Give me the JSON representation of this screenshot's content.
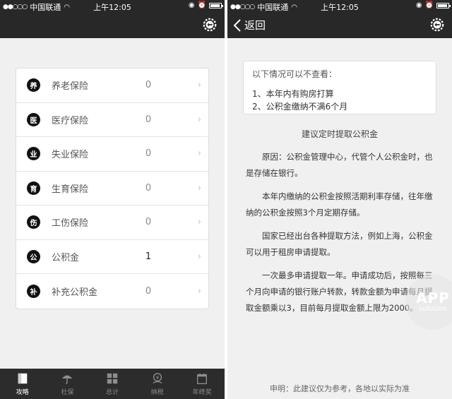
{
  "status_bar": {
    "signal": "●●○○○",
    "carrier": "中国联通",
    "time": "上午12:05"
  },
  "left": {
    "list": [
      {
        "badge": "养",
        "label": "养老保险",
        "value": "0"
      },
      {
        "badge": "医",
        "label": "医疗保险",
        "value": "0"
      },
      {
        "badge": "业",
        "label": "失业保险",
        "value": "0"
      },
      {
        "badge": "育",
        "label": "生育保险",
        "value": "0"
      },
      {
        "badge": "伤",
        "label": "工伤保险",
        "value": "0"
      },
      {
        "badge": "公",
        "label": "公积金",
        "value": "1"
      },
      {
        "badge": "补",
        "label": "补充公积金",
        "value": "0"
      }
    ],
    "tabs": [
      {
        "label": "攻略",
        "icon": "book-icon"
      },
      {
        "label": "社保",
        "icon": "umbrella-icon"
      },
      {
        "label": "总计",
        "icon": "grid-icon"
      },
      {
        "label": "纳税",
        "icon": "yen-icon"
      },
      {
        "label": "年终奖",
        "icon": "calendar-icon"
      }
    ]
  },
  "right": {
    "back_label": "返回",
    "notice": {
      "title": "以下情况可以不查看：",
      "items": [
        "1、本年内有购房打算",
        "2、公积金缴纳不满6个月"
      ]
    },
    "advice_title": "建议定时提取公积金",
    "paragraphs": [
      "原因：公积金管理中心，代管个人公积金时，也是存储在银行。",
      "本年内缴纳的公积金按照活期利率存储，往年缴纳的公积金按照3个月定期存储。",
      "国家已经出台各种提取方法，例如上海，公积金可以用于租房申请提取。",
      "一次最多申请提取一年。申请成功后，按照每三个月向申请的银行账户转款，转款金额为申请每月提取金额乘以3，目前每月提取金额上限为2000。"
    ],
    "disclaimer": "申明：此建议仅为参考，各地以实际为准"
  },
  "watermark": {
    "app": "APP",
    "solution": "solution"
  },
  "colors": {
    "bar_dark": "#282828",
    "tabbar": "#2c2c2c",
    "background": "#f0f0f0",
    "card": "#ffffff"
  }
}
